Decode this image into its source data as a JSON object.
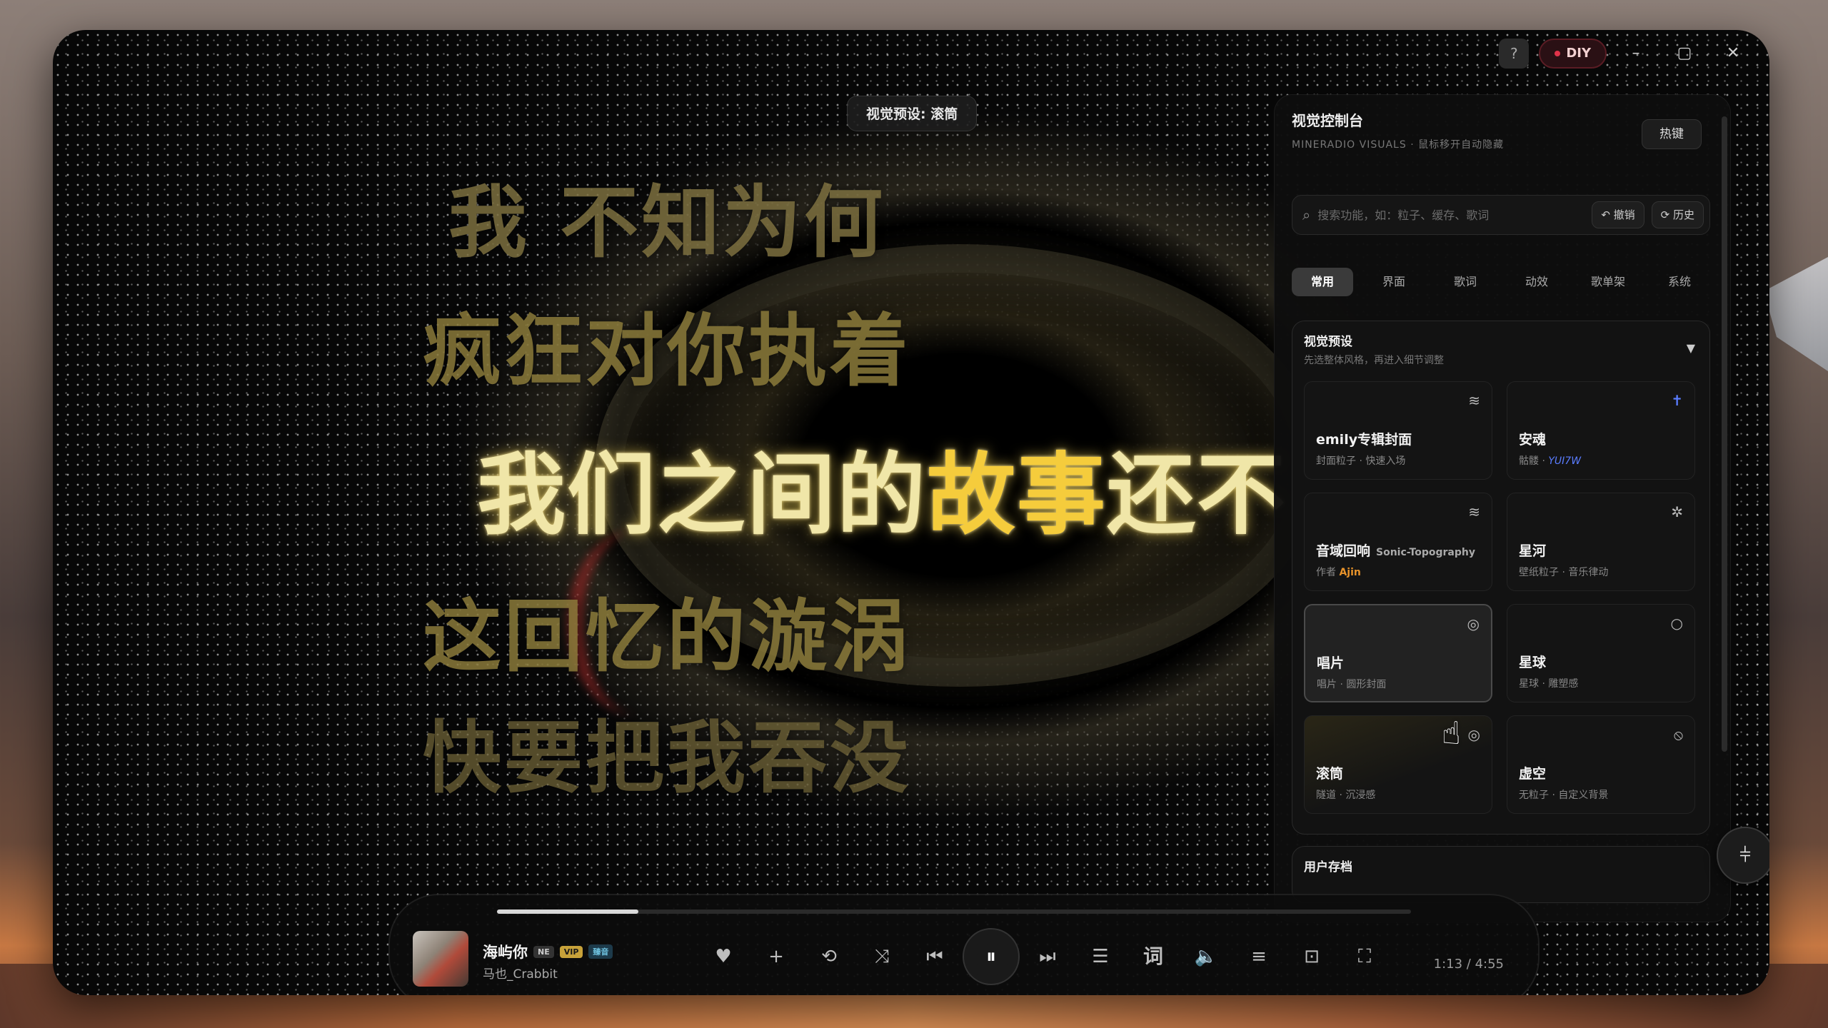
{
  "window": {
    "preset_pill": "视觉预设: 滚筒"
  },
  "lyrics": {
    "line1": "我 不知为何",
    "line2": "疯狂对你执着",
    "active_prefix": "我们之间的",
    "active_highlight": "故事",
    "active_suffix": "还不",
    "line4": "这回忆的漩涡",
    "line5": "快要把我吞没"
  },
  "titlebar": {
    "help": "?",
    "diy": "DIY",
    "minimize": "–",
    "maximize": "▢",
    "close": "✕"
  },
  "panel": {
    "title": "视觉控制台",
    "subtitle": "MINERADIO VISUALS · 鼠标移开自动隐藏",
    "hotkey": "热键",
    "search": {
      "placeholder": "搜索功能，如：粒子、缓存、歌词",
      "undo": "↶ 撤销",
      "history": "⟳ 历史"
    },
    "tabs": [
      "常用",
      "界面",
      "歌词",
      "动效",
      "歌单架",
      "系统"
    ],
    "active_tab": "常用",
    "presets": {
      "title": "视觉预设",
      "subtitle": "先选整体风格，再进入细节调整",
      "cards": [
        {
          "name": "emily专辑封面",
          "desc": "封面粒子 · 快速入场",
          "icon": "≋"
        },
        {
          "name": "安魂",
          "desc_prefix": "骷髅 · ",
          "desc_accent": "YUI7W",
          "icon": "✝"
        },
        {
          "name": "音域回响",
          "name_en": "Sonic-Topography",
          "desc_prefix": "作者 ",
          "desc_author": "Ajin",
          "icon": "≋"
        },
        {
          "name": "星河",
          "desc": "壁纸粒子 · 音乐律动",
          "icon": "✲"
        },
        {
          "name": "唱片",
          "desc": "唱片 · 圆形封面",
          "icon": "◎"
        },
        {
          "name": "星球",
          "desc": "星球 · 雕塑感",
          "icon": "○"
        },
        {
          "name": "滚筒",
          "desc": "隧道 · 沉浸感",
          "icon": "◎"
        },
        {
          "name": "虚空",
          "desc": "无粒子 · 自定义背景",
          "icon": "⦸"
        }
      ]
    },
    "user_save": {
      "title": "用户存档"
    },
    "fab_icon": "⫩"
  },
  "player": {
    "song": "海屿你",
    "badge_ne": "NE",
    "badge_vip": "VIP",
    "badge_quality": "臻音",
    "artist": "马也_Crabbit",
    "progress": 0.155,
    "time": "1:13 / 4:55",
    "controls": {
      "like": "♥",
      "add": "+",
      "repeat": "⟲",
      "shuffle": "⤨",
      "prev": "⏮",
      "pause": "⏸",
      "next": "⏭",
      "playlist": "☰",
      "lyric": "词",
      "volume": "🔈",
      "eq": "≡",
      "screenshot": "⊡",
      "fullscreen": "⛶"
    }
  }
}
